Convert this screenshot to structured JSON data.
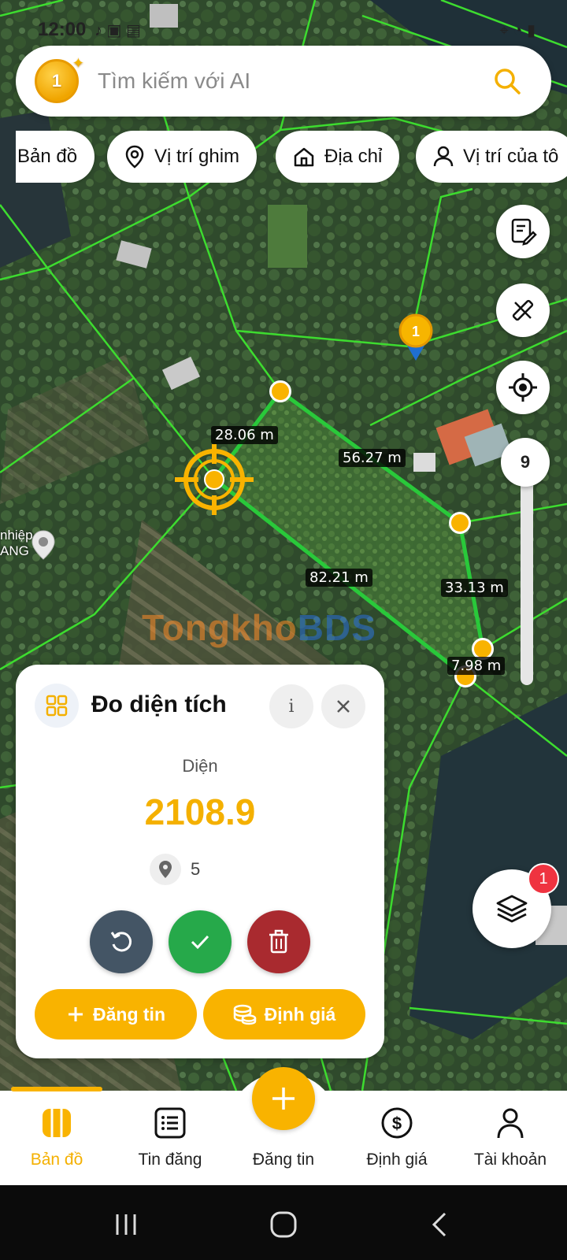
{
  "status_bar": {
    "time": "12:00"
  },
  "search": {
    "placeholder": "Tìm kiếm với AI"
  },
  "chips": [
    {
      "label": "Bản đồ",
      "icon": "map-icon"
    },
    {
      "label": "Vị trí ghim",
      "icon": "pin-icon"
    },
    {
      "label": "Địa chỉ",
      "icon": "home-icon"
    },
    {
      "label": "Vị trí của tô",
      "icon": "person-icon"
    }
  ],
  "map": {
    "segment_labels": [
      "28.06 m",
      "56.27 m",
      "33.13 m",
      "82.21 m",
      "7.98 m"
    ],
    "poi_text": [
      "nhiệp",
      "ANG"
    ],
    "watermark": {
      "part1": "Tongkho",
      "part2": "BDS"
    },
    "zoom_level": "9"
  },
  "measure_panel": {
    "title": "Đo diện tích",
    "info_symbol": "i",
    "area_label": "Diện",
    "area_value": "2108.9",
    "point_count": "5",
    "post_button": "Đăng tin",
    "valuate_button": "Định giá"
  },
  "layers": {
    "badge_count": "1"
  },
  "bottom_nav": [
    {
      "label": "Bản đồ",
      "icon": "map-icon",
      "active": true
    },
    {
      "label": "Tin đăng",
      "icon": "list-icon",
      "active": false
    },
    {
      "label": "Đăng tin",
      "icon": "plus-icon",
      "active": false
    },
    {
      "label": "Định giá",
      "icon": "dollar-icon",
      "active": false
    },
    {
      "label": "Tài khoản",
      "icon": "user-icon",
      "active": false
    }
  ],
  "colors": {
    "accent": "#f9b300",
    "measure_line": "#2ecc40",
    "parcel_line": "#3ddc2f",
    "delete": "#a92a2f",
    "confirm": "#26a94a",
    "undo": "#445565"
  }
}
